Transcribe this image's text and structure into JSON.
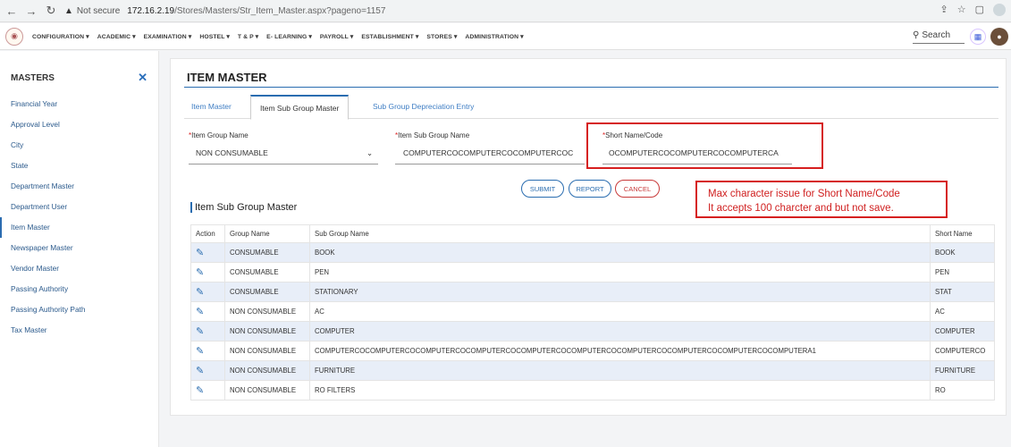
{
  "browser": {
    "secure_label": "Not secure",
    "url_host": "172.16.2.19",
    "url_path": "/Stores/Masters/Str_Item_Master.aspx?pageno=1157"
  },
  "nav": {
    "items": [
      "CONFIGURATION ▾",
      "ACADEMIC ▾",
      "EXAMINATION ▾",
      "HOSTEL ▾",
      "T & P ▾",
      "E- LEARNING ▾",
      "PAYROLL ▾",
      "ESTABLISHMENT ▾",
      "STORES ▾",
      "ADMINISTRATION ▾"
    ],
    "search_label": "Search"
  },
  "sidebar": {
    "title": "MASTERS",
    "items": [
      "Financial Year",
      "Approval Level",
      "City",
      "State",
      "Department Master",
      "Department User",
      "Item Master",
      "Newspaper Master",
      "Vendor Master",
      "Passing Authority",
      "Passing Authority Path",
      "Tax Master"
    ]
  },
  "main": {
    "title": "ITEM MASTER",
    "tabs": [
      "Item Master",
      "Item Sub Group Master",
      "Sub Group Depreciation Entry"
    ],
    "form": {
      "group_label": "Item Group Name",
      "group_value": "NON CONSUMABLE",
      "subgroup_label": "Item Sub Group Name",
      "subgroup_value": "COMPUTERCOCOMPUTERCOCOMPUTERCOC",
      "short_label": "Short Name/Code",
      "short_value": "OCOMPUTERCOCOMPUTERCOCOMPUTERCA"
    },
    "buttons": {
      "submit": "SUBMIT",
      "report": "REPORT",
      "cancel": "CANCEL"
    },
    "note_line1": "Max character issue for Short Name/Code",
    "note_line2": "It accepts 100 charcter and but not save.",
    "section_title": "Item Sub Group Master",
    "table": {
      "headers": [
        "Action",
        "Group Name",
        "Sub Group Name",
        "Short Name"
      ],
      "rows": [
        [
          "CONSUMABLE",
          "BOOK",
          "BOOK"
        ],
        [
          "CONSUMABLE",
          "PEN",
          "PEN"
        ],
        [
          "CONSUMABLE",
          "STATIONARY",
          "STAT"
        ],
        [
          "NON CONSUMABLE",
          "AC",
          "AC"
        ],
        [
          "NON CONSUMABLE",
          "COMPUTER",
          "COMPUTER"
        ],
        [
          "NON CONSUMABLE",
          "COMPUTERCOCOMPUTERCOCOMPUTERCOCOMPUTERCOCOMPUTERCOCOMPUTERCOCOMPUTERCOCOMPUTERCOCOMPUTERCOCOMPUTERA1",
          "COMPUTERCO"
        ],
        [
          "NON CONSUMABLE",
          "FURNITURE",
          "FURNITURE"
        ],
        [
          "NON CONSUMABLE",
          "RO FILTERS",
          "RO"
        ]
      ]
    }
  }
}
